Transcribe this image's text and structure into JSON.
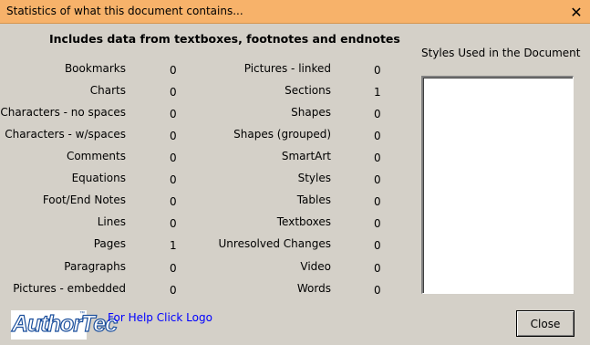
{
  "window": {
    "title": "Statistics of what this document contains...",
    "close_glyph": "✕",
    "close_icon": "close-icon"
  },
  "heading": "Includes data from textboxes, footnotes and endnotes",
  "stats_left": [
    {
      "label": "Bookmarks",
      "value": "0"
    },
    {
      "label": "Charts",
      "value": "0"
    },
    {
      "label": "Characters - no spaces",
      "value": "0"
    },
    {
      "label": "Characters - w/spaces",
      "value": "0"
    },
    {
      "label": "Comments",
      "value": "0"
    },
    {
      "label": "Equations",
      "value": "0"
    },
    {
      "label": "Foot/End Notes",
      "value": "0"
    },
    {
      "label": "Lines",
      "value": "0"
    },
    {
      "label": "Pages",
      "value": "1"
    },
    {
      "label": "Paragraphs",
      "value": "0"
    },
    {
      "label": "Pictures - embedded",
      "value": "0"
    }
  ],
  "stats_right": [
    {
      "label": "Pictures - linked",
      "value": "0"
    },
    {
      "label": "Sections",
      "value": "1"
    },
    {
      "label": "Shapes",
      "value": "0"
    },
    {
      "label": "Shapes (grouped)",
      "value": "0"
    },
    {
      "label": "SmartArt",
      "value": "0"
    },
    {
      "label": "Styles",
      "value": "0"
    },
    {
      "label": "Tables",
      "value": "0"
    },
    {
      "label": "Textboxes",
      "value": "0"
    },
    {
      "label": "Unresolved Changes",
      "value": "0"
    },
    {
      "label": "Video",
      "value": "0"
    },
    {
      "label": "Words",
      "value": "0"
    }
  ],
  "styles_panel": {
    "label": "Styles Used in the Document",
    "items": []
  },
  "footer": {
    "logo_text": "AuthorTec",
    "logo_tm": "™",
    "help_link": "For Help Click Logo",
    "close_button": "Close"
  },
  "colors": {
    "titlebar": "#f7b26a",
    "dialog_bg": "#d4d0c8",
    "link": "#0000ff",
    "logo_blue": "#1a4e9c"
  }
}
